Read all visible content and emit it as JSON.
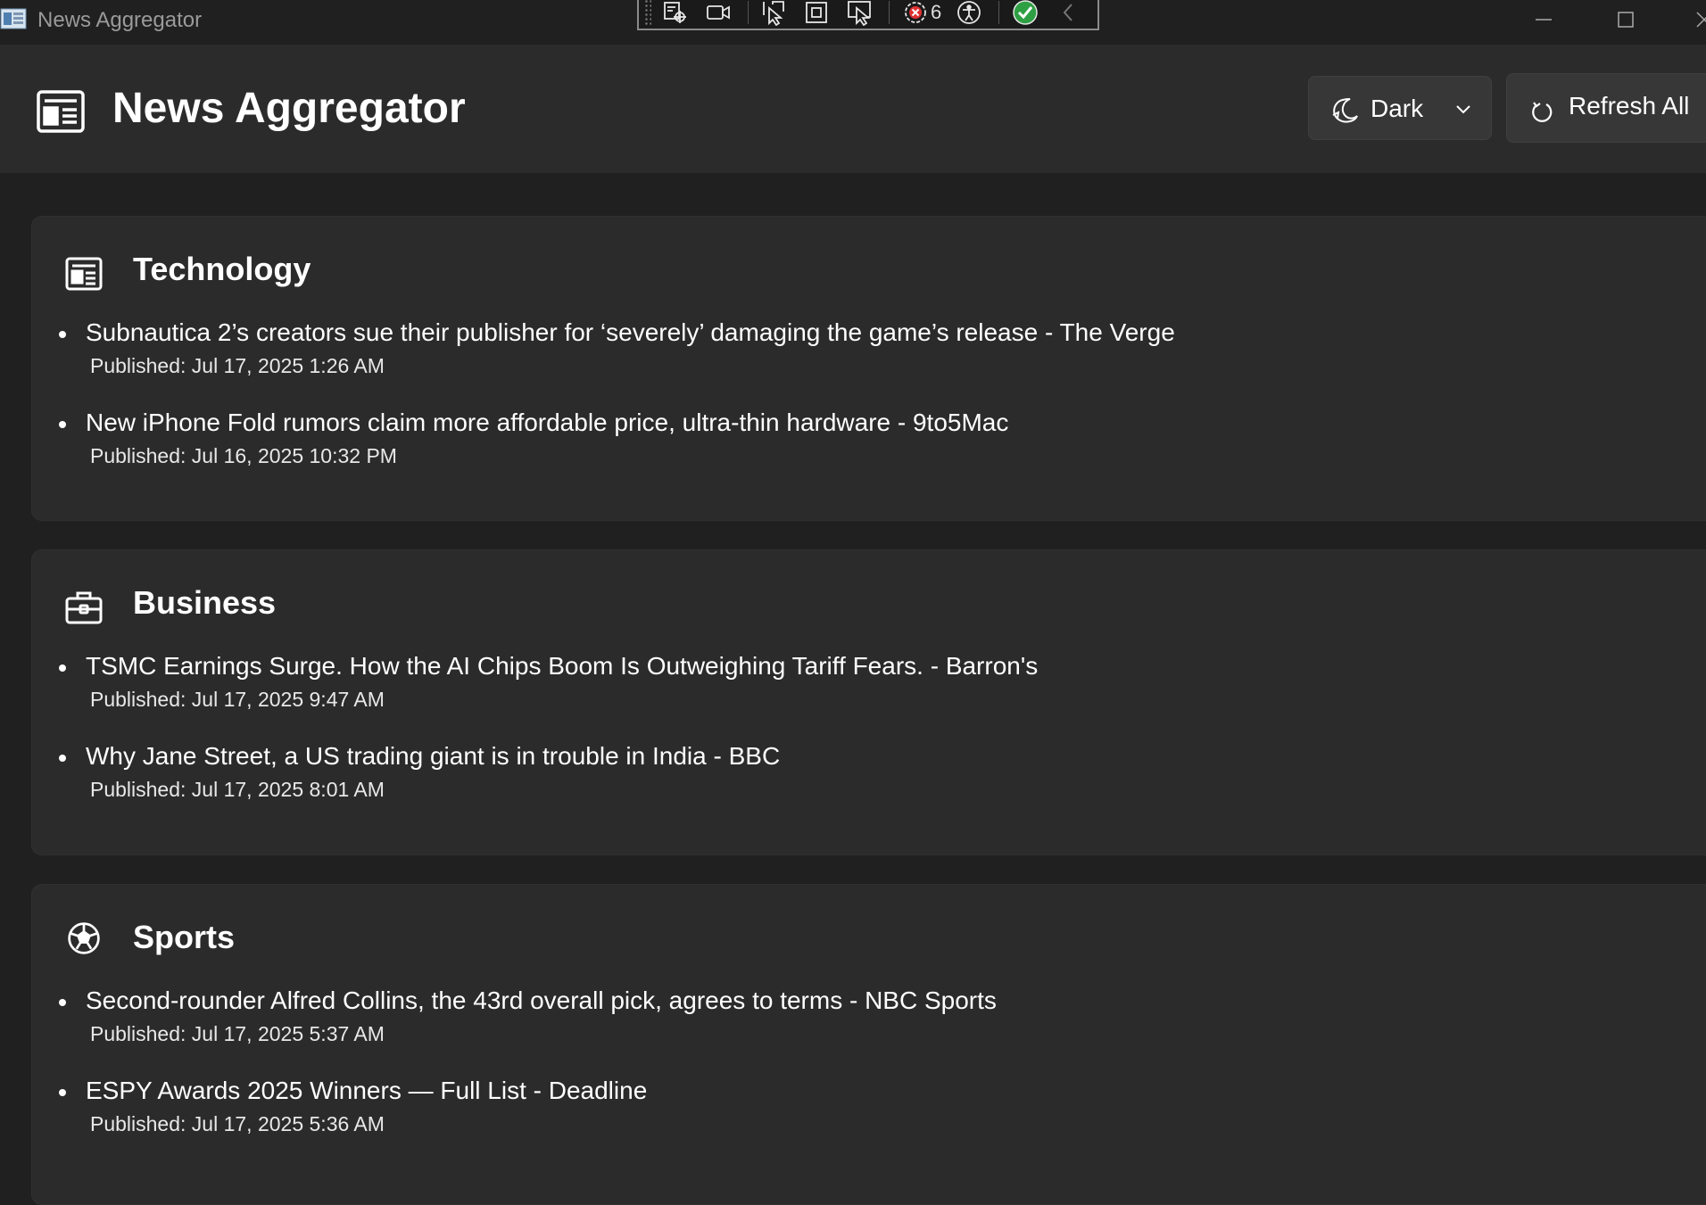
{
  "window": {
    "title": "News Aggregator",
    "debug_counter": "6"
  },
  "header": {
    "title": "News Aggregator",
    "theme": {
      "selected": "Dark"
    },
    "refresh_label": "Refresh All"
  },
  "categories": [
    {
      "name": "Technology",
      "icon": "newspaper-icon",
      "articles": [
        {
          "headline": "Subnautica 2’s creators sue their publisher for ‘severely’ damaging the game’s release - The Verge",
          "published": "Published: Jul 17, 2025 1:26 AM"
        },
        {
          "headline": "New iPhone Fold rumors claim more affordable price, ultra-thin hardware - 9to5Mac",
          "published": "Published: Jul 16, 2025 10:32 PM"
        }
      ]
    },
    {
      "name": "Business",
      "icon": "briefcase-icon",
      "articles": [
        {
          "headline": "TSMC Earnings Surge. How the AI Chips Boom Is Outweighing Tariff Fears. - Barron's",
          "published": "Published: Jul 17, 2025 9:47 AM"
        },
        {
          "headline": "Why Jane Street, a US trading giant is in trouble in India - BBC",
          "published": "Published: Jul 17, 2025 8:01 AM"
        }
      ]
    },
    {
      "name": "Sports",
      "icon": "soccer-ball-icon",
      "articles": [
        {
          "headline": "Second-rounder Alfred Collins, the 43rd overall pick, agrees to terms - NBC Sports",
          "published": "Published: Jul 17, 2025 5:37 AM"
        },
        {
          "headline": "ESPY Awards 2025 Winners — Full List - Deadline",
          "published": "Published: Jul 17, 2025 5:36 AM"
        }
      ]
    }
  ],
  "colors": {
    "background": "#202020",
    "surface": "#2b2b2b",
    "control": "#373737",
    "text": "#ffffff"
  }
}
